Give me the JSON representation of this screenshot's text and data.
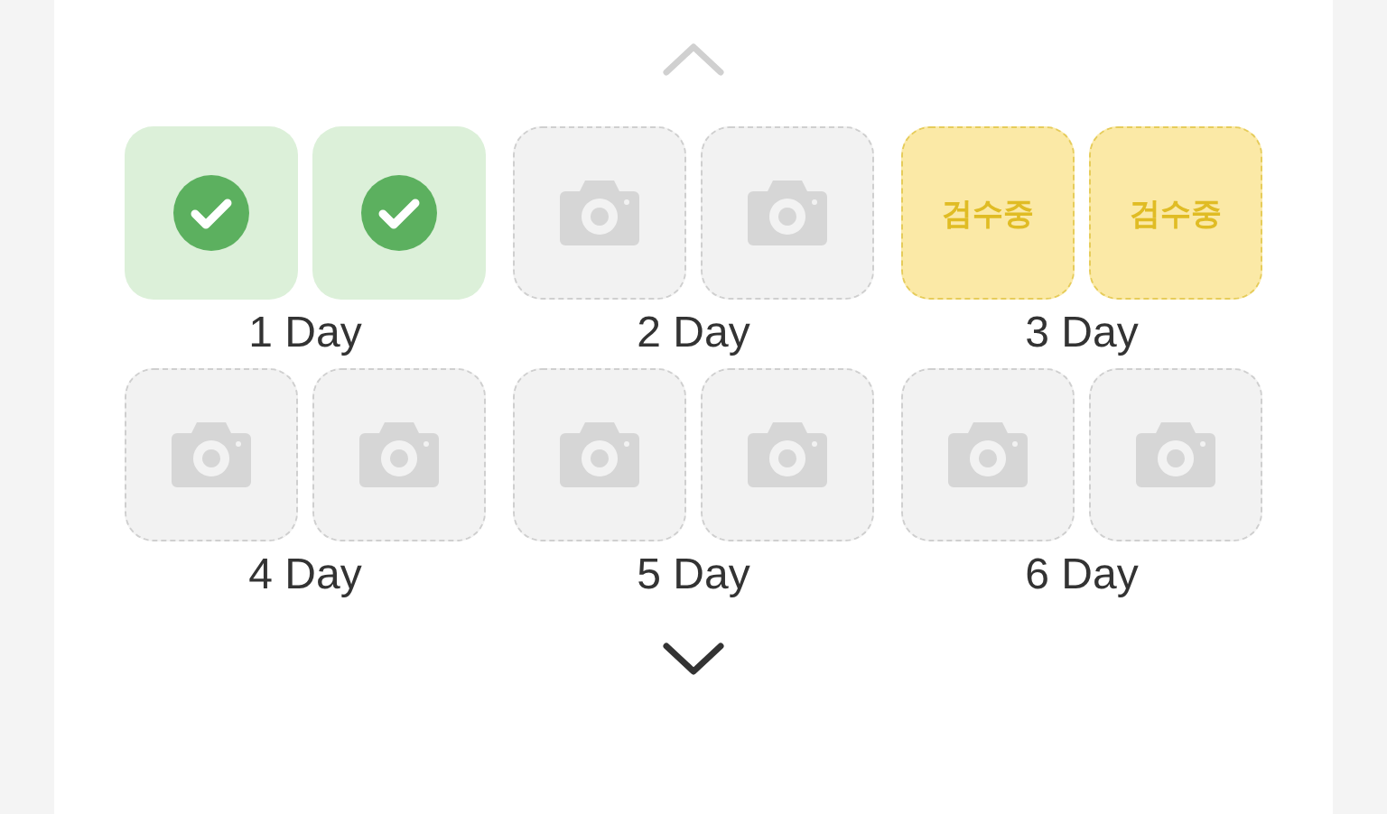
{
  "nav_up": {
    "disabled": true
  },
  "days": [
    {
      "label": "1 Day",
      "slots": [
        {
          "kind": "done"
        },
        {
          "kind": "done"
        }
      ]
    },
    {
      "label": "2 Day",
      "slots": [
        {
          "kind": "empty"
        },
        {
          "kind": "empty"
        }
      ]
    },
    {
      "label": "3 Day",
      "slots": [
        {
          "kind": "review",
          "text": "검수중"
        },
        {
          "kind": "review",
          "text": "검수중"
        }
      ]
    },
    {
      "label": "4 Day",
      "slots": [
        {
          "kind": "empty"
        },
        {
          "kind": "empty"
        }
      ]
    },
    {
      "label": "5 Day",
      "slots": [
        {
          "kind": "empty"
        },
        {
          "kind": "empty"
        }
      ]
    },
    {
      "label": "6 Day",
      "slots": [
        {
          "kind": "empty"
        },
        {
          "kind": "empty"
        }
      ]
    }
  ],
  "nav_down": {
    "disabled": false
  }
}
